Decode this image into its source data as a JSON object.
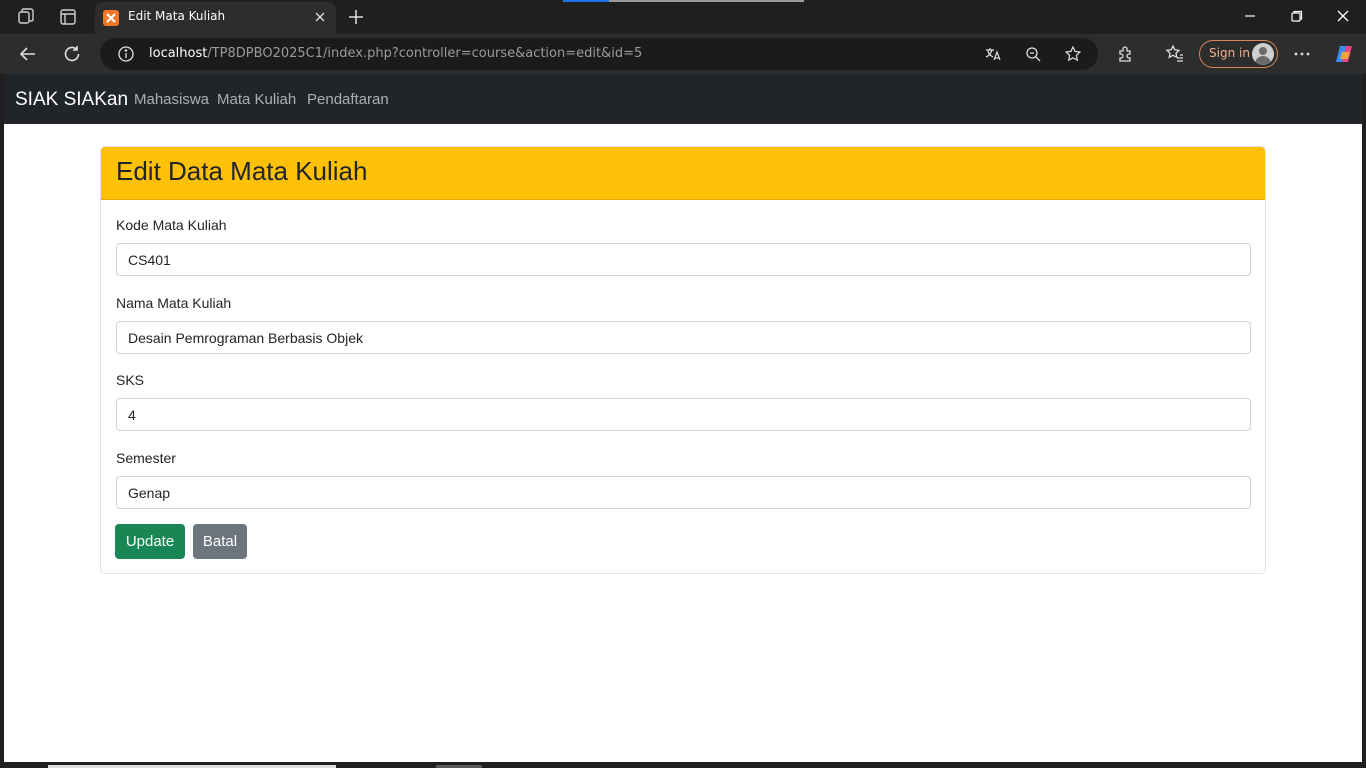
{
  "browser": {
    "tab_title": "Edit Mata Kuliah",
    "url_host": "localhost",
    "url_path": "/TP8DPBO2025C1/index.php?controller=course&action=edit&id=5",
    "sign_in_label": "Sign in"
  },
  "navbar": {
    "brand": "SIAK SIAKan",
    "links": [
      "Mahasiswa",
      "Mata Kuliah",
      "Pendaftaran"
    ]
  },
  "form": {
    "title": "Edit Data Mata Kuliah",
    "fields": [
      {
        "label": "Kode Mata Kuliah",
        "value": "CS401"
      },
      {
        "label": "Nama Mata Kuliah",
        "value": "Desain Pemrograman Berbasis Objek"
      },
      {
        "label": "SKS",
        "value": "4"
      },
      {
        "label": "Semester",
        "value": "Genap"
      }
    ],
    "update_label": "Update",
    "cancel_label": "Batal"
  },
  "colors": {
    "header_accent": "#ffc107",
    "update_button": "#198754",
    "cancel_button": "#6c757d",
    "navbar_bg": "#212529"
  }
}
